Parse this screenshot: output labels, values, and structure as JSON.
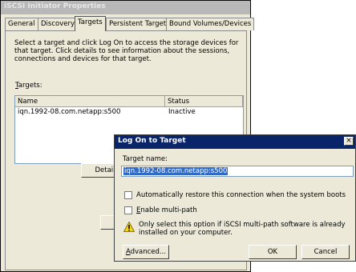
{
  "main": {
    "title": "iSCSI Initiator Properties",
    "tabs": [
      "General",
      "Discovery",
      "Targets",
      "Persistent Targets",
      "Bound Volumes/Devices"
    ],
    "active_tab": "Targets",
    "description": "Select a target and click Log On to access the storage devices for that target. Click details to see information about the sessions, connections and devices for that target.",
    "targets_label_u": "T",
    "targets_label_rest": "argets:",
    "list": {
      "col_name": "Name",
      "col_status": "Status",
      "rows": [
        {
          "name": "iqn.1992-08.com.netapp:s500",
          "status": "Inactive"
        }
      ]
    },
    "details_button": "Detail"
  },
  "dialog": {
    "title": "Log On to Target",
    "close": "×",
    "target_name_label": "Target name:",
    "target_name_value": "iqn.1992-08.com.netapp:s500",
    "auto_restore": {
      "label": "Automatically restore this connection when the system boots",
      "checked": false
    },
    "multipath_label_u": "E",
    "multipath_label_rest": "nable multi-path",
    "multipath_checked": false,
    "warning_text": "Only select this option if iSCSI multi-path software is already installed on your computer.",
    "icon_warning": "warning-icon",
    "advanced_u": "A",
    "advanced_rest": "dvanced...",
    "ok": "OK",
    "cancel": "Cancel"
  }
}
